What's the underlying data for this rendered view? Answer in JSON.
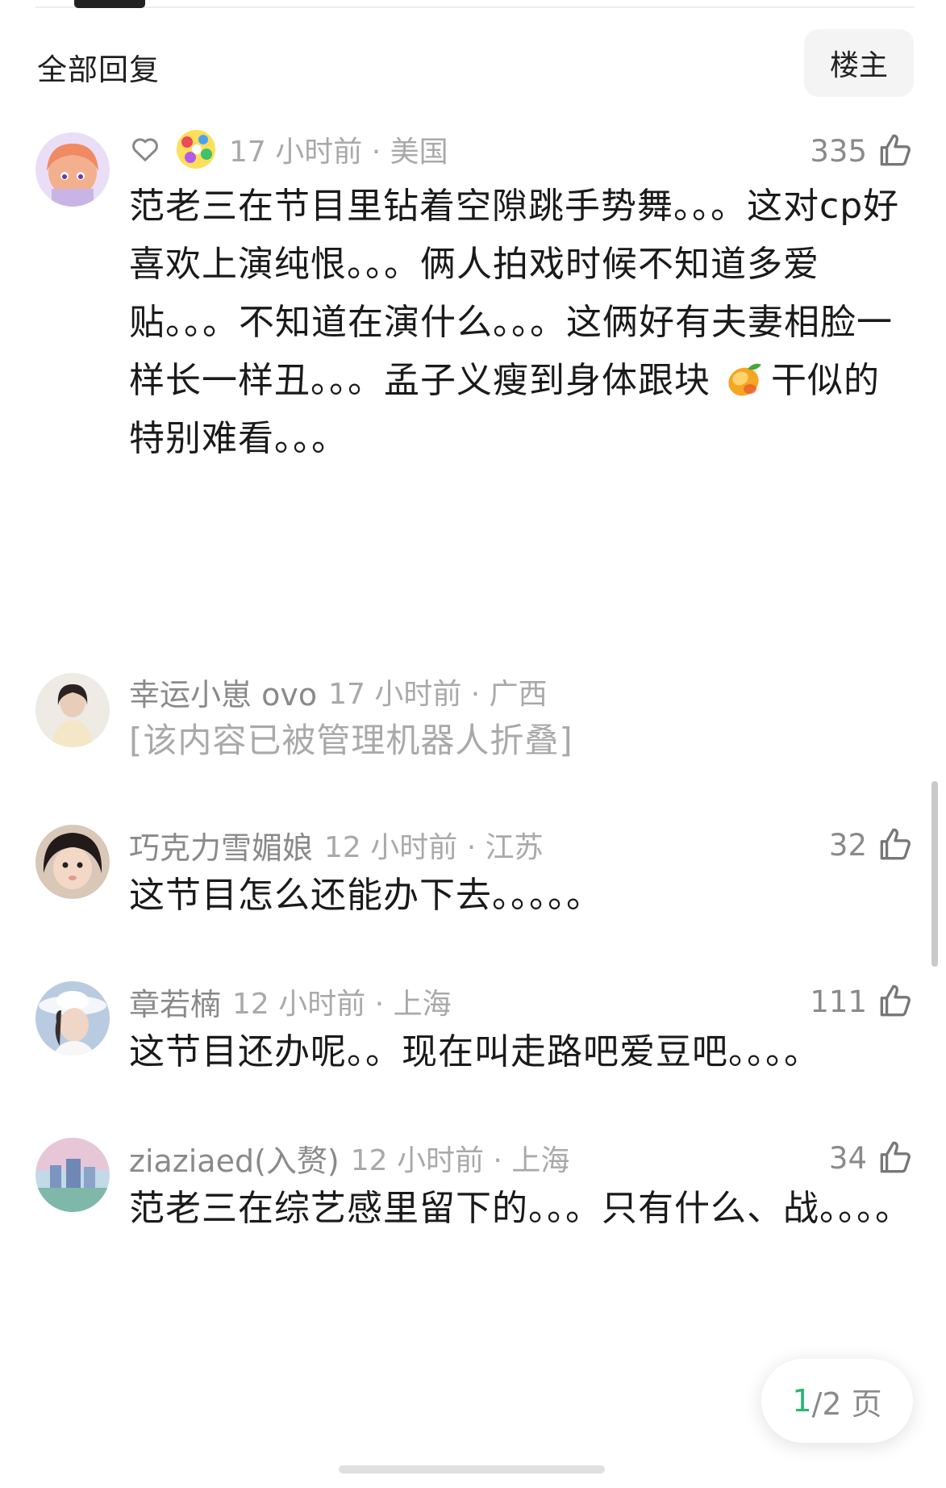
{
  "header": {
    "title": "全部回复",
    "op_filter": "楼主"
  },
  "comments": [
    {
      "time_location": "17 小时前 · 美国",
      "likes": "335",
      "text": "范老三在节目里钻着空隙跳手势舞。。。这对cp好喜欢上演纯恨。。。俩人拍戏时候不知道多爱贴。。。不知道在演什么。。。这俩好有夫妻相脸一样长一样丑。。。孟子义瘦到身体跟块",
      "text_tail": "干似的特别难看。。。",
      "emoji": "mango"
    },
    {
      "username": "幸运小崽 ovo",
      "time_location": "17 小时前 · 广西",
      "text": "[该内容已被管理机器人折叠]"
    },
    {
      "username": "巧克力雪媚娘",
      "time_location": "12 小时前 · 江苏",
      "likes": "32",
      "text": "这节目怎么还能办下去。。。。。"
    },
    {
      "username": "章若楠",
      "time_location": "12 小时前 · 上海",
      "likes": "111",
      "text": "这节目还办呢。。现在叫走路吧爱豆吧。。。。"
    },
    {
      "username": "ziaziaed(入赘)",
      "time_location": "12 小时前 · 上海",
      "likes": "34",
      "text": "范老三在综艺感里留下的。。。只有什么、战。。。。"
    }
  ],
  "pagination": {
    "current": "1",
    "total": "/2 页"
  },
  "colors": {
    "accent_green": "#2bb673",
    "meta_gray": "#a9a9a9"
  }
}
